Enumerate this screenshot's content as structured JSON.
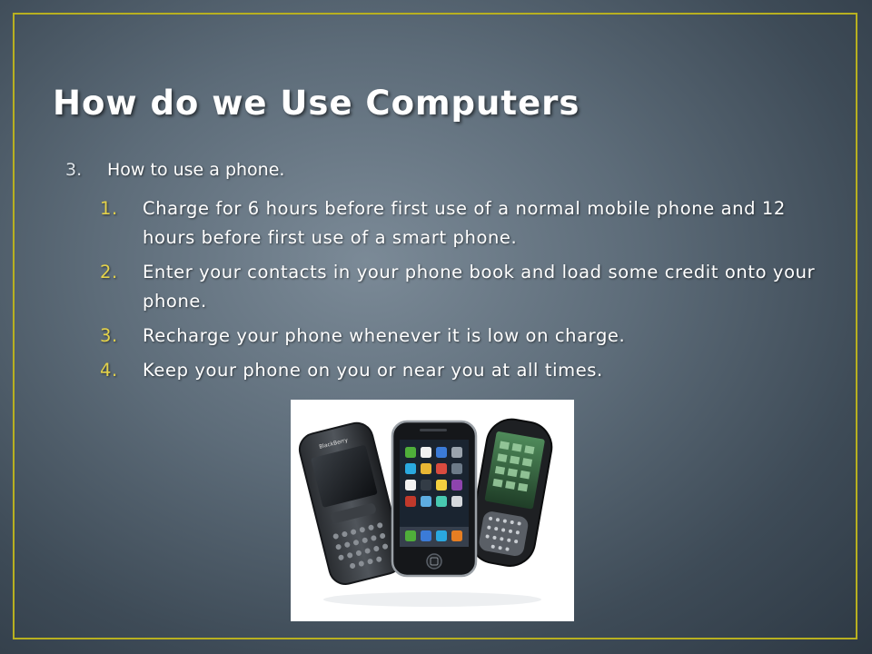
{
  "slide": {
    "title": "How do we Use Computers",
    "item": {
      "number": "3.",
      "text": "How to use a phone.",
      "subitems": [
        {
          "number": "1.",
          "text": "Charge for 6 hours before first use of a normal mobile phone and 12 hours before first use of a smart phone."
        },
        {
          "number": "2.",
          "text": "Enter your contacts in your phone book and load some credit onto your phone."
        },
        {
          "number": "3.",
          "text": "Recharge your phone whenever it is low on charge."
        },
        {
          "number": "4.",
          "text": "Keep your phone on you or near you at all times."
        }
      ]
    },
    "colors": {
      "frame": "#b8b020",
      "sub_numbers": "#e4d24a",
      "background": "#5d6c79"
    }
  },
  "image": {
    "icon": "phones-image"
  }
}
